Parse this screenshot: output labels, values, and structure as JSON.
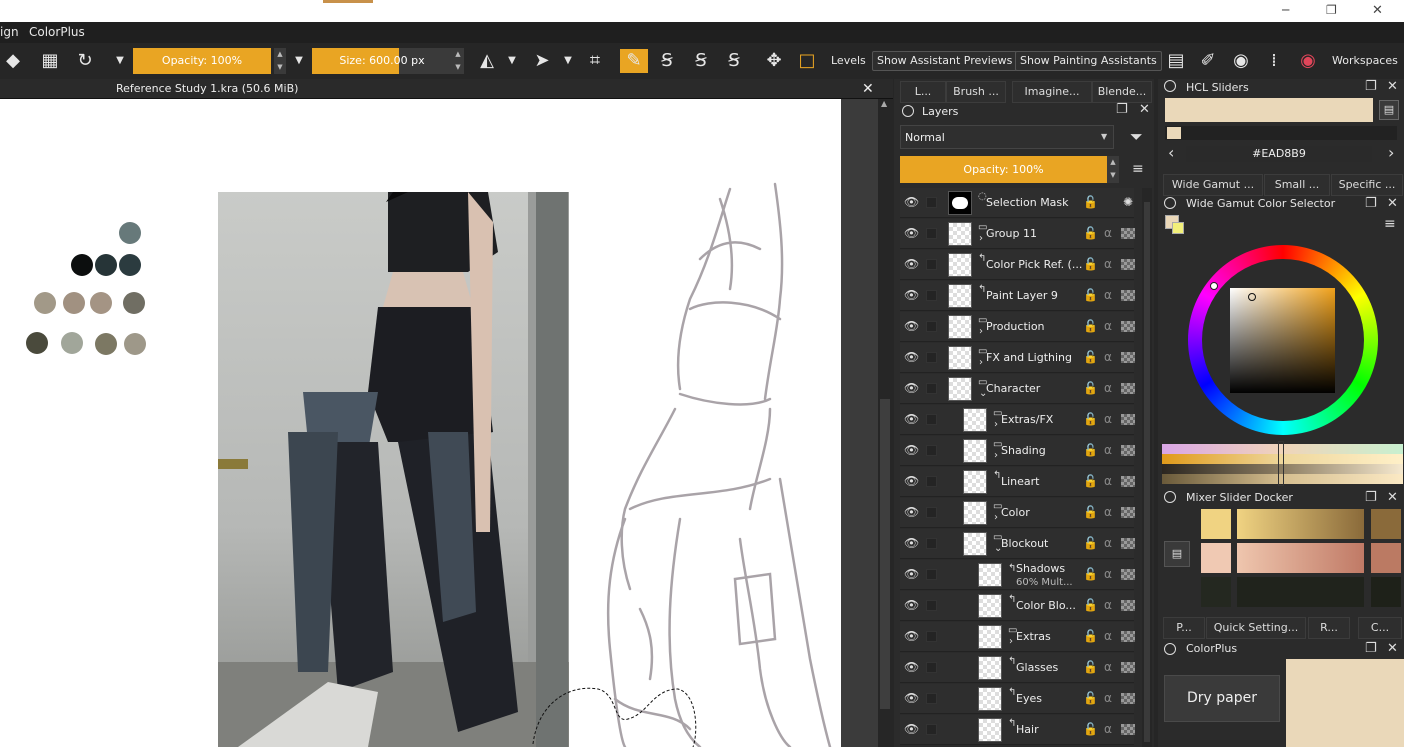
{
  "menubar": {
    "item_partial": "ign",
    "item_colorplus": "ColorPlus"
  },
  "window_controls": {
    "minimize": "─",
    "maximize": "❐",
    "close": "✕"
  },
  "toolbar": {
    "opacity_label": "Opacity: 100%",
    "size_label": "Size: 600.00 px",
    "levels_label": "Levels",
    "show_assistant_previews": "Show Assistant Previews",
    "show_painting_assistants": "Show Painting Assistants",
    "workspaces_label": "Workspaces",
    "accent_color": "#E9A523"
  },
  "document": {
    "tab_title": "Reference Study 1.kra (50.6 MiB)",
    "close": "✕"
  },
  "palette_swatches": [
    "#67797a",
    "#0c0e0e",
    "#263437",
    "#2b3b3f",
    "#a29988",
    "#a19181",
    "#a49484",
    "#706e63",
    "#4a4a3c",
    "#a1a69a",
    "#7c7863",
    "#9e9889"
  ],
  "layers_docker": {
    "tabs": [
      "L...",
      "Brush ...",
      "Imagine...",
      "Blende..."
    ],
    "title": "Layers",
    "blend_mode": "Normal",
    "opacity_label": "Opacity:  100%",
    "layers": [
      {
        "name": "Selection Mask",
        "sub": "",
        "indent": 0,
        "kind": "mask"
      },
      {
        "name": "Group 11",
        "sub": "",
        "indent": 0,
        "kind": "group",
        "expand": "›"
      },
      {
        "name": "Color Pick Ref. (...",
        "sub": "",
        "indent": 0,
        "kind": "paint"
      },
      {
        "name": "Paint Layer 9",
        "sub": "",
        "indent": 0,
        "kind": "paint"
      },
      {
        "name": "Production",
        "sub": "",
        "indent": 0,
        "kind": "group",
        "expand": "›"
      },
      {
        "name": "FX and Ligthing",
        "sub": "",
        "indent": 0,
        "kind": "group",
        "expand": "›"
      },
      {
        "name": "Character",
        "sub": "",
        "indent": 0,
        "kind": "group",
        "expand": "⌄"
      },
      {
        "name": "Extras/FX",
        "sub": "",
        "indent": 1,
        "kind": "group",
        "expand": "›"
      },
      {
        "name": "Shading",
        "sub": "",
        "indent": 1,
        "kind": "group",
        "expand": "›"
      },
      {
        "name": "Lineart",
        "sub": "",
        "indent": 1,
        "kind": "paint"
      },
      {
        "name": "Color",
        "sub": "",
        "indent": 1,
        "kind": "group",
        "expand": "›"
      },
      {
        "name": "Blockout",
        "sub": "",
        "indent": 1,
        "kind": "group",
        "expand": "⌄"
      },
      {
        "name": "Shadows",
        "sub": "60% Mult...",
        "indent": 2,
        "kind": "paint"
      },
      {
        "name": "Color Blo...",
        "sub": "",
        "indent": 2,
        "kind": "paint"
      },
      {
        "name": "Extras",
        "sub": "",
        "indent": 2,
        "kind": "group",
        "expand": "›"
      },
      {
        "name": "Glasses",
        "sub": "",
        "indent": 2,
        "kind": "paint"
      },
      {
        "name": "Eyes",
        "sub": "",
        "indent": 2,
        "kind": "paint"
      },
      {
        "name": "Hair",
        "sub": "",
        "indent": 2,
        "kind": "paint"
      }
    ]
  },
  "hcl_sliders": {
    "title": "HCL Sliders",
    "hex_value": "#EAD8B9",
    "current_color": "#EAD8B9",
    "prev_arrow": "‹",
    "next_arrow": "›"
  },
  "color_tabs": [
    "Wide Gamut ...",
    "Small ...",
    "Specific ..."
  ],
  "wide_gamut": {
    "title": "Wide Gamut Color Selector"
  },
  "mixer": {
    "title": "Mixer Slider Docker"
  },
  "bottom_tabs": [
    "P...",
    "Quick Setting...",
    "R...",
    "C..."
  ],
  "colorplus": {
    "title": "ColorPlus",
    "dry_paper_label": "Dry paper",
    "swatch_color": "#EAD8B9"
  }
}
